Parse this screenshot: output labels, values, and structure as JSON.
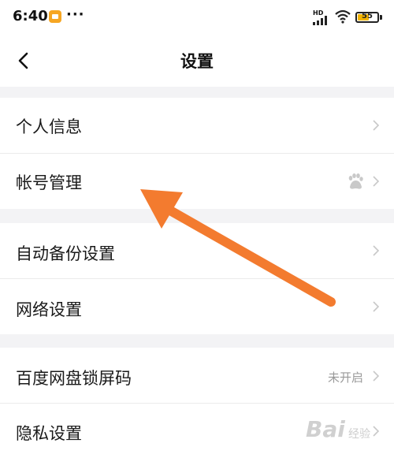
{
  "status_bar": {
    "time": "6:40",
    "dots": "···",
    "network": "HD",
    "battery": "55"
  },
  "header": {
    "title": "设置"
  },
  "sections": [
    {
      "items": [
        {
          "label": "个人信息"
        },
        {
          "label": "帐号管理"
        }
      ]
    },
    {
      "items": [
        {
          "label": "自动备份设置"
        },
        {
          "label": "网络设置"
        }
      ]
    },
    {
      "items": [
        {
          "label": "百度网盘锁屏码",
          "status": "未开启"
        },
        {
          "label": "隐私设置"
        }
      ]
    }
  ],
  "watermark": {
    "brand": "Bai",
    "sub": "经验"
  },
  "colors": {
    "arrow": "#f37b2f",
    "battery": "#f3b400",
    "app_badge": "#f6a623"
  }
}
